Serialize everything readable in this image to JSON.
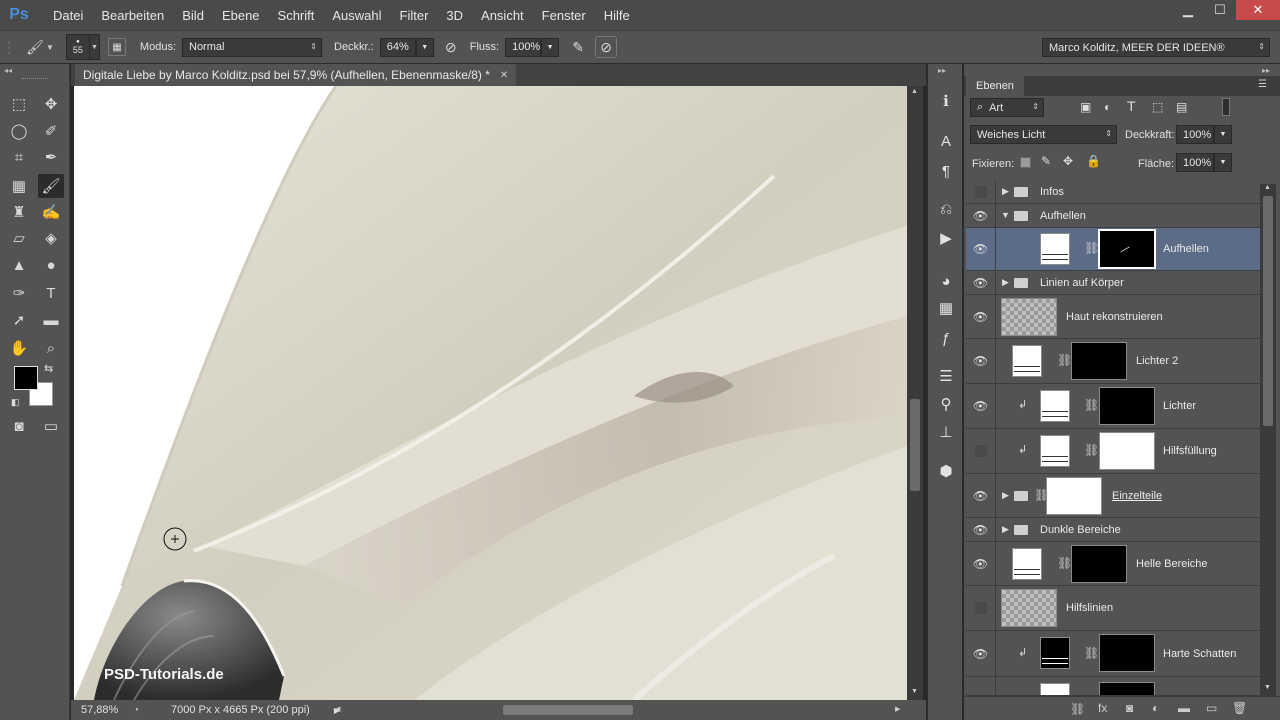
{
  "app": {
    "logo": "Ps"
  },
  "menu": [
    "Datei",
    "Bearbeiten",
    "Bild",
    "Ebene",
    "Schrift",
    "Auswahl",
    "Filter",
    "3D",
    "Ansicht",
    "Fenster",
    "Hilfe"
  ],
  "window_controls": {
    "minimize": "▁",
    "maximize": "☐",
    "close": "✕"
  },
  "options": {
    "brush_size": "55",
    "modus_label": "Modus:",
    "modus_value": "Normal",
    "deckkr_label": "Deckkr.:",
    "deckkr_value": "64%",
    "fluss_label": "Fluss:",
    "fluss_value": "100%",
    "workspace": "Marco Kolditz, MEER DER IDEEN®"
  },
  "document": {
    "tab_title": "Digitale Liebe by Marco Kolditz.psd bei 57,9% (Aufhellen, Ebenenmaske/8) *",
    "close": "✕",
    "watermark": "PSD-Tutorials.de"
  },
  "status": {
    "zoom": "57,88%",
    "docinfo": "7000 Px x 4665 Px (200 ppi)"
  },
  "layers_panel": {
    "tab": "Ebenen",
    "filter_kind": "Art",
    "blend_mode": "Weiches Licht",
    "deckkraft_label": "Deckkraft:",
    "deckkraft_value": "100%",
    "fixieren_label": "Fixieren:",
    "flaeche_label": "Fläche:",
    "flaeche_value": "100%",
    "layers": [
      {
        "name": "Infos",
        "kind": "group",
        "visible": false
      },
      {
        "name": "Aufhellen",
        "kind": "group-open",
        "visible": true
      },
      {
        "name": "Aufhellen",
        "kind": "adjust-mask",
        "visible": true,
        "selected": true
      },
      {
        "name": "Linien auf Körper",
        "kind": "group",
        "visible": true
      },
      {
        "name": "Haut rekonstruieren",
        "kind": "pixel",
        "visible": true
      },
      {
        "name": "Lichter 2",
        "kind": "adjust-mask",
        "visible": true
      },
      {
        "name": "Lichter",
        "kind": "adjust-mask",
        "visible": true,
        "clipped": true
      },
      {
        "name": "Hilfsfüllung",
        "kind": "adjust-mask",
        "visible": false,
        "clipped": true
      },
      {
        "name": "Einzelteile",
        "kind": "group-mask",
        "visible": true
      },
      {
        "name": "Dunkle Bereiche",
        "kind": "group",
        "visible": true
      },
      {
        "name": "Helle Bereiche",
        "kind": "adjust-mask",
        "visible": true
      },
      {
        "name": "Hilfslinien",
        "kind": "pixel",
        "visible": false
      },
      {
        "name": "Harte Schatten",
        "kind": "adjust-mask",
        "visible": true,
        "clipped": true
      }
    ]
  }
}
